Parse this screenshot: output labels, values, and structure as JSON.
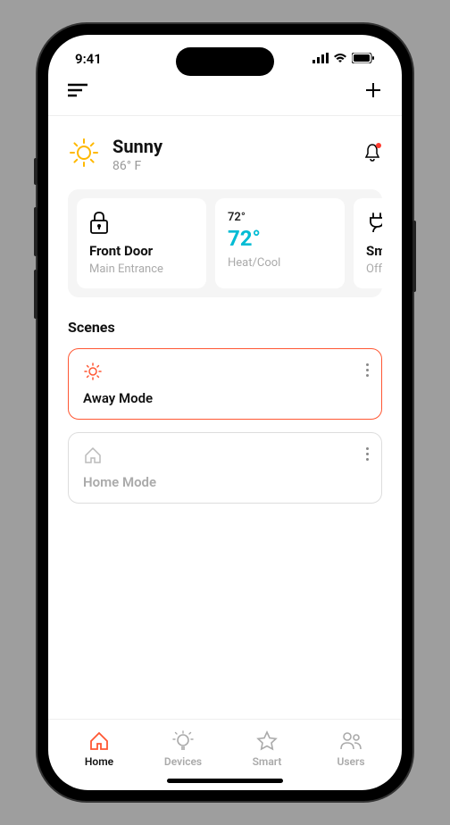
{
  "status": {
    "time": "9:41"
  },
  "weather": {
    "condition": "Sunny",
    "temp": "86° F"
  },
  "cards": [
    {
      "kind": "lock",
      "title": "Front Door",
      "subtitle": "Main Entrance"
    },
    {
      "kind": "thermostat",
      "small": "72°",
      "big": "72°",
      "subtitle": "Heat/Cool"
    },
    {
      "kind": "plug",
      "title": "Smart Plug",
      "subtitle": "Off"
    }
  ],
  "sections": {
    "scenes_title": "Scenes"
  },
  "scenes": [
    {
      "label": "Away Mode",
      "active": true,
      "icon": "sun"
    },
    {
      "label": "Home Mode",
      "active": false,
      "icon": "home"
    }
  ],
  "tabs": [
    {
      "label": "Home",
      "active": true
    },
    {
      "label": "Devices",
      "active": false
    },
    {
      "label": "Smart",
      "active": false
    },
    {
      "label": "Users",
      "active": false
    }
  ],
  "colors": {
    "accent": "#ff5733",
    "thermostat": "#00bcd4"
  }
}
